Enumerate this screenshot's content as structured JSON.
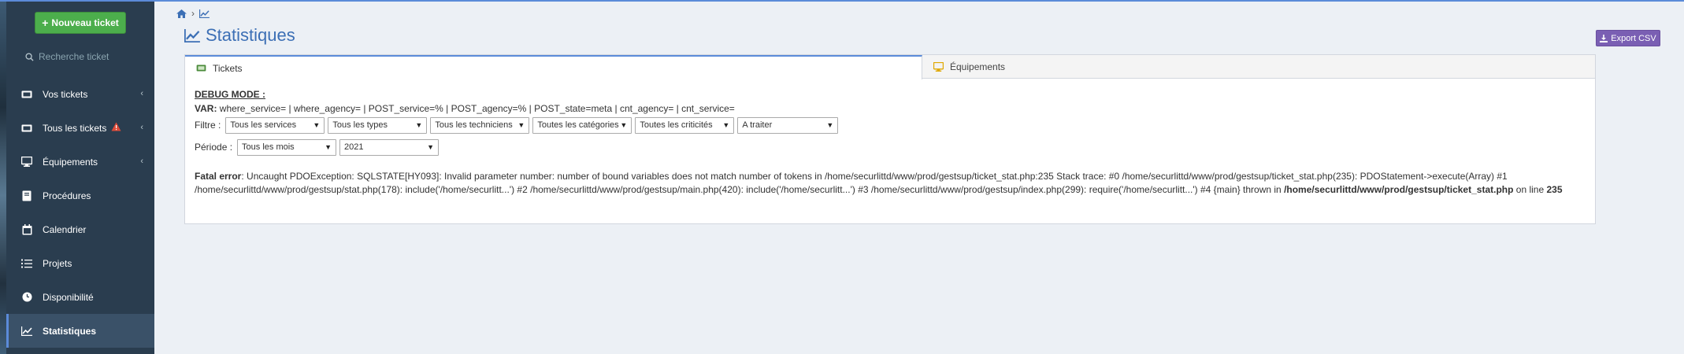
{
  "sidebar": {
    "new_ticket_label": "Nouveau ticket",
    "search_placeholder": "Recherche ticket",
    "items": [
      {
        "label": "Vos tickets",
        "icon": "ticket-icon",
        "has_chevron": true
      },
      {
        "label": "Tous les tickets",
        "icon": "ticket-icon",
        "has_chevron": true,
        "warning": true
      },
      {
        "label": "Équipements",
        "icon": "desktop-icon",
        "has_chevron": true
      },
      {
        "label": "Procédures",
        "icon": "book-icon",
        "has_chevron": false
      },
      {
        "label": "Calendrier",
        "icon": "calendar-icon",
        "has_chevron": false
      },
      {
        "label": "Projets",
        "icon": "list-icon",
        "has_chevron": false
      },
      {
        "label": "Disponibilité",
        "icon": "clock-icon",
        "has_chevron": false
      },
      {
        "label": "Statistiques",
        "icon": "chart-line-icon",
        "has_chevron": false,
        "active": true
      }
    ]
  },
  "header": {
    "title": "Statistiques",
    "export_label": "Export CSV"
  },
  "tabs": [
    {
      "label": "Tickets",
      "active": true
    },
    {
      "label": "Équipements",
      "active": false
    }
  ],
  "content": {
    "debug_title": "DEBUG MODE :",
    "var_label": "VAR:",
    "var_text": " where_service= | where_agency= | POST_service=% | POST_agency=% | POST_state=meta | cnt_agency= | cnt_service=",
    "filter_label": "Filtre :",
    "filters": [
      "Tous les services",
      "Tous les types",
      "Tous les techniciens",
      "Toutes les catégories",
      "Toutes les criticités",
      "A traiter"
    ],
    "period_label": "Période :",
    "periods": [
      "Tous les mois",
      "2021"
    ],
    "error_label": "Fatal error",
    "error_text": ": Uncaught PDOException: SQLSTATE[HY093]: Invalid parameter number: number of bound variables does not match number of tokens in /home/securlittd/www/prod/gestsup/ticket_stat.php:235 Stack trace: #0 /home/securlittd/www/prod/gestsup/ticket_stat.php(235): PDOStatement->execute(Array) #1 /home/securlittd/www/prod/gestsup/stat.php(178): include('/home/securlitt...') #2 /home/securlittd/www/prod/gestsup/main.php(420): include('/home/securlitt...') #3 /home/securlittd/www/prod/gestsup/index.php(299): require('/home/securlitt...') #4 {main} thrown in ",
    "error_file": "/home/securlittd/www/prod/gestsup/ticket_stat.php",
    "error_on_line": " on line ",
    "error_line": "235"
  },
  "colors": {
    "sidebar_bg": "#2a3d4f",
    "accent": "#3c6fb5",
    "new_ticket_btn": "#4cae4c",
    "export_btn": "#7a5fb3",
    "warning": "#dd4b39"
  }
}
